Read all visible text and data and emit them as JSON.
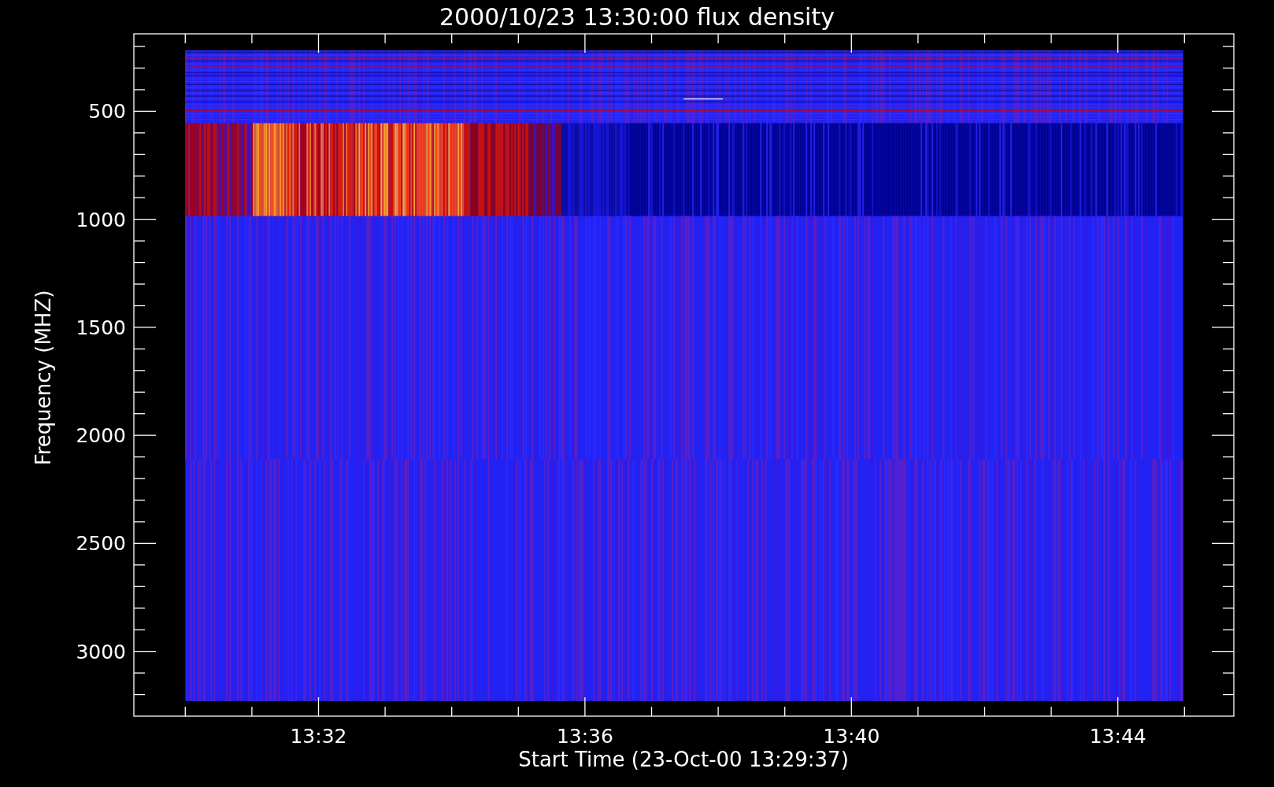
{
  "title": "2000/10/23 13:30:00 flux density",
  "xlabel": "Start Time (23-Oct-00 13:29:37)",
  "ylabel": "Frequency (MHZ)",
  "xtick_labels": [
    "13:32",
    "13:36",
    "13:40",
    "13:44"
  ],
  "ytick_labels": [
    "500",
    "1000",
    "1500",
    "2000",
    "2500",
    "3000"
  ]
}
